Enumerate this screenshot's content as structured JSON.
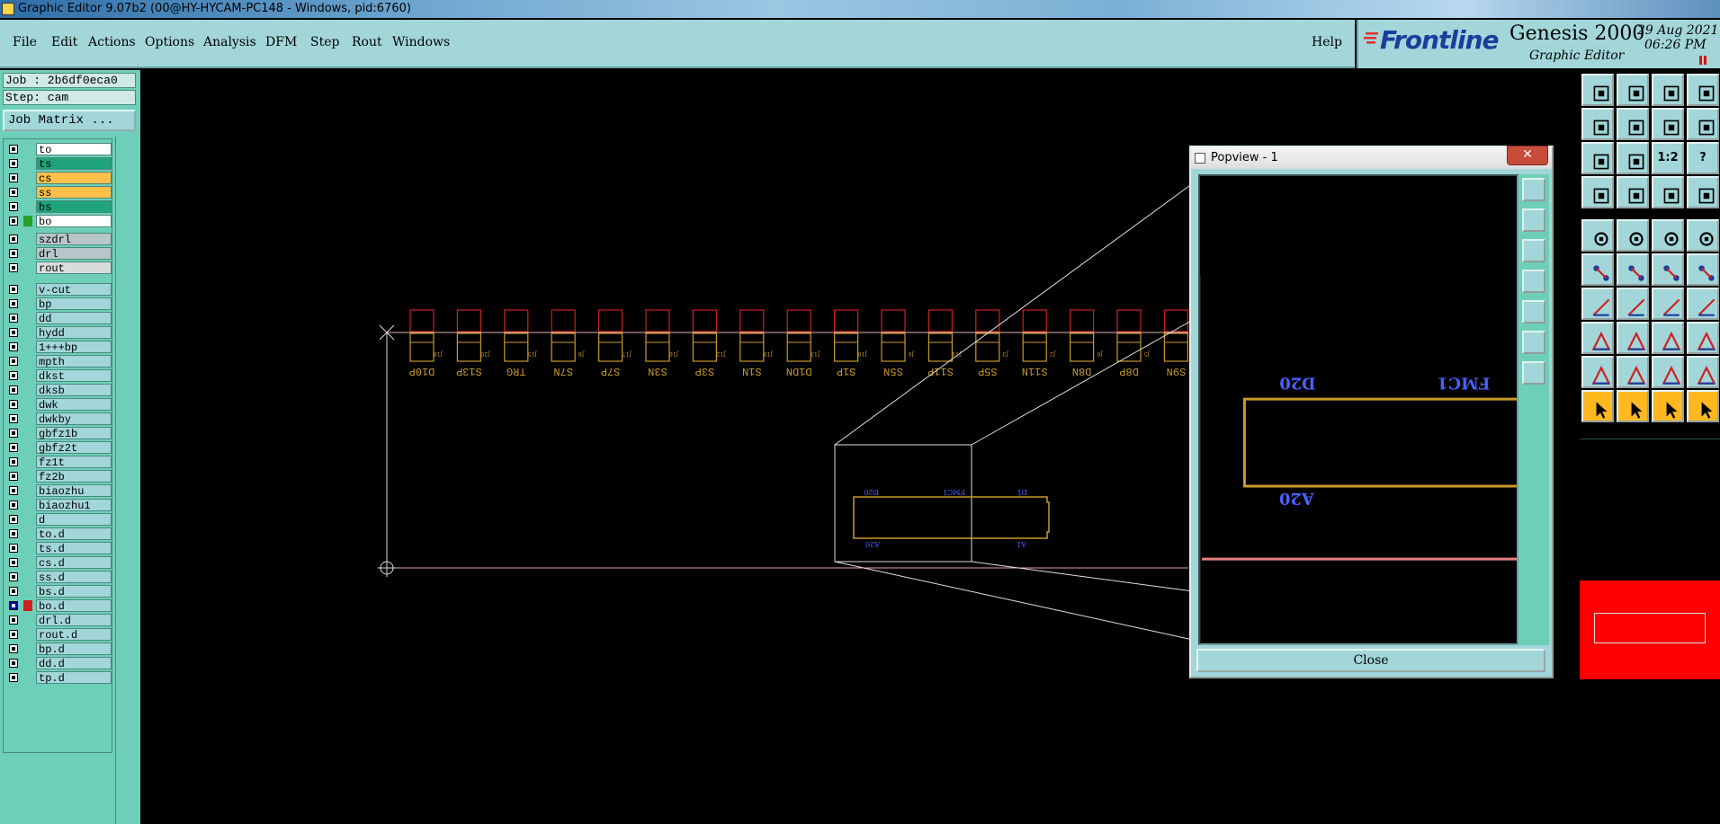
{
  "window": {
    "title": "Graphic Editor 9.07b2 (00@HY-HYCAM-PC148 - Windows, pid:6760)"
  },
  "menu": {
    "items": [
      "File",
      "Edit",
      "Actions",
      "Options",
      "Analysis",
      "DFM",
      "Step",
      "Rout",
      "Windows"
    ],
    "help": "Help"
  },
  "brand": {
    "logo_text": "Frontline",
    "product": "Genesis 2000",
    "subtitle": "Graphic Editor",
    "date": "29 Aug 2021",
    "time": "06:26 PM"
  },
  "panel": {
    "job": "Job : 2b6df0eca0",
    "step": "Step: cam",
    "job_matrix": "Job Matrix ..."
  },
  "layers": [
    {
      "name": "to",
      "color": "#ffffff",
      "flag": ""
    },
    {
      "name": "ts",
      "color": "#1fa37a",
      "flag": ""
    },
    {
      "name": "cs",
      "color": "#ffc04a",
      "flag": "✶"
    },
    {
      "name": "ss",
      "color": "#ffc04a",
      "flag": "✶"
    },
    {
      "name": "bs",
      "color": "#1fa37a",
      "flag": "✶"
    },
    {
      "name": "bo",
      "color": "#ffffff",
      "flag": ""
    },
    {
      "name": "szdrl",
      "color": "#b8c6c8",
      "flag": ""
    },
    {
      "name": "drl",
      "color": "#b8c6c8",
      "flag": ""
    },
    {
      "name": "rout",
      "color": "#d8dcdc",
      "flag": ""
    },
    {
      "name": "v-cut",
      "color": "#a2d6d9",
      "flag": ""
    },
    {
      "name": "bp",
      "color": "#a2d6d9",
      "flag": ""
    },
    {
      "name": "dd",
      "color": "#a2d6d9",
      "flag": ""
    },
    {
      "name": "hydd",
      "color": "#a2d6d9",
      "flag": ""
    },
    {
      "name": "1+++bp",
      "color": "#a2d6d9",
      "flag": ""
    },
    {
      "name": "mpth",
      "color": "#a2d6d9",
      "flag": ""
    },
    {
      "name": "dkst",
      "color": "#a2d6d9",
      "flag": ""
    },
    {
      "name": "dksb",
      "color": "#a2d6d9",
      "flag": ""
    },
    {
      "name": "dwk",
      "color": "#a2d6d9",
      "flag": ""
    },
    {
      "name": "dwkby",
      "color": "#a2d6d9",
      "flag": ""
    },
    {
      "name": "gbfz1b",
      "color": "#a2d6d9",
      "flag": ""
    },
    {
      "name": "gbfz2t",
      "color": "#a2d6d9",
      "flag": ""
    },
    {
      "name": "fz1t",
      "color": "#a2d6d9",
      "flag": ""
    },
    {
      "name": "fz2b",
      "color": "#a2d6d9",
      "flag": ""
    },
    {
      "name": "biaozhu",
      "color": "#a2d6d9",
      "flag": ""
    },
    {
      "name": "biaozhu1",
      "color": "#a2d6d9",
      "flag": ""
    },
    {
      "name": "d",
      "color": "#a2d6d9",
      "flag": ""
    },
    {
      "name": "to.d",
      "color": "#a2d6d9",
      "flag": ""
    },
    {
      "name": "ts.d",
      "color": "#a2d6d9",
      "flag": ""
    },
    {
      "name": "cs.d",
      "color": "#a2d6d9",
      "flag": "✶"
    },
    {
      "name": "ss.d",
      "color": "#a2d6d9",
      "flag": "✶"
    },
    {
      "name": "bs.d",
      "color": "#a2d6d9",
      "flag": "✶"
    },
    {
      "name": "bo.d",
      "color": "#a2d6d9",
      "flag": "▦",
      "active": true
    },
    {
      "name": "drl.d",
      "color": "#a2d6d9",
      "flag": ""
    },
    {
      "name": "rout.d",
      "color": "#a2d6d9",
      "flag": ""
    },
    {
      "name": "bp.d",
      "color": "#a2d6d9",
      "flag": ""
    },
    {
      "name": "dd.d",
      "color": "#a2d6d9",
      "flag": ""
    },
    {
      "name": "tp.d",
      "color": "#a2d6d9",
      "flag": ""
    }
  ],
  "pads": {
    "labels": [
      "D10P",
      "S13P",
      "TRG",
      "S7N",
      "S7P",
      "S3N",
      "S3P",
      "S1N",
      "D1DN",
      "S1P",
      "S5N",
      "S11P",
      "S5P",
      "S11N",
      "D8N",
      "D8P",
      "S9N"
    ],
    "pin_labels": [
      "J18",
      "J20",
      "J15",
      "J8",
      "J17",
      "J16",
      "J12",
      "J19",
      "J13",
      "J10",
      "J4",
      "J14",
      "J3",
      "J2",
      "J6",
      "J5",
      "J9"
    ]
  },
  "zoom_box": {
    "top_left": "D20",
    "top_right": "FMC1",
    "right": "D1",
    "bottom_left": "A20",
    "bottom_right": "A1"
  },
  "popview": {
    "title": "Popview - 1",
    "close_x": "✕",
    "close_button": "Close",
    "label_top_left": "D20",
    "label_top_right": "FMC1",
    "label_bottom": "A20"
  },
  "toolbar": {
    "icons": [
      "open-step-icon",
      "save-icon",
      "home-icon",
      "window-icon",
      "prev-step-icon",
      "next-step-icon",
      "undo-view-icon",
      "split-view-icon",
      "zoom-fit-icon",
      "zoom-center-icon",
      "zoom-ratio-icon",
      "query-icon",
      "measure-icon",
      "snap-icon",
      "select-net-icon",
      "select-features-icon",
      "move-icon",
      "route-icon",
      "ruler-icon",
      "pad-icon",
      "connect-icon",
      "delete-icon",
      "add-line-icon",
      "add-point-icon",
      "angle-icon",
      "line-draw-icon",
      "arc-icon",
      "ff-icon",
      "transform-icon",
      "line-icon",
      "dimension-icon",
      "copy-icon",
      "triangle-icon",
      "triangle-a-icon",
      "a-icon",
      "a-select-icon",
      "pointer-icon",
      "pointer-box-icon",
      "pointer-zoom-icon",
      "pointer-graph-icon"
    ],
    "zoom_ratio_label": "1:2",
    "query_label": "?"
  },
  "colors": {
    "panel": "#a2d6d9",
    "panel_dark": "#6ecfb8",
    "outline": "#c89a2a",
    "pad_red": "#cc2020",
    "blue_text": "#4a62ff"
  }
}
